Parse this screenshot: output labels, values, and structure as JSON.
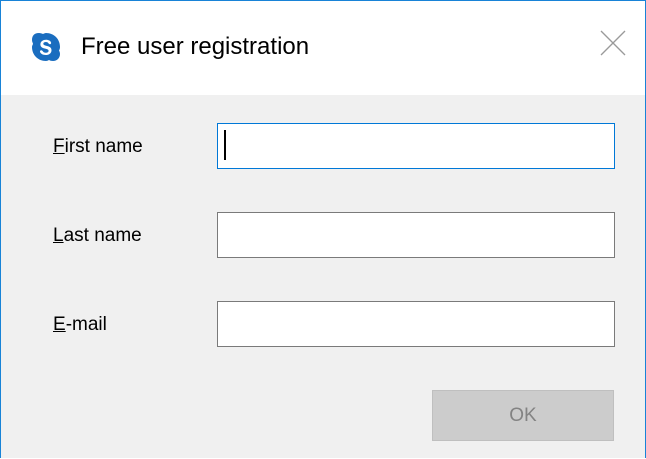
{
  "window": {
    "title": "Free user registration",
    "app_icon": "skype-s-icon",
    "close_icon": "close-icon"
  },
  "form": {
    "first_name": {
      "label_accel": "F",
      "label_rest": "irst name",
      "value": ""
    },
    "last_name": {
      "label_accel": "L",
      "label_rest": "ast name",
      "value": ""
    },
    "email": {
      "label_accel": "E",
      "label_rest": "-mail",
      "value": ""
    }
  },
  "buttons": {
    "ok_label": "OK"
  },
  "colors": {
    "accent": "#0078d7",
    "window_border": "#1883d7",
    "disabled_button": "#cccccc",
    "disabled_text": "#838383",
    "icon_blue": "#1a6dbf"
  }
}
